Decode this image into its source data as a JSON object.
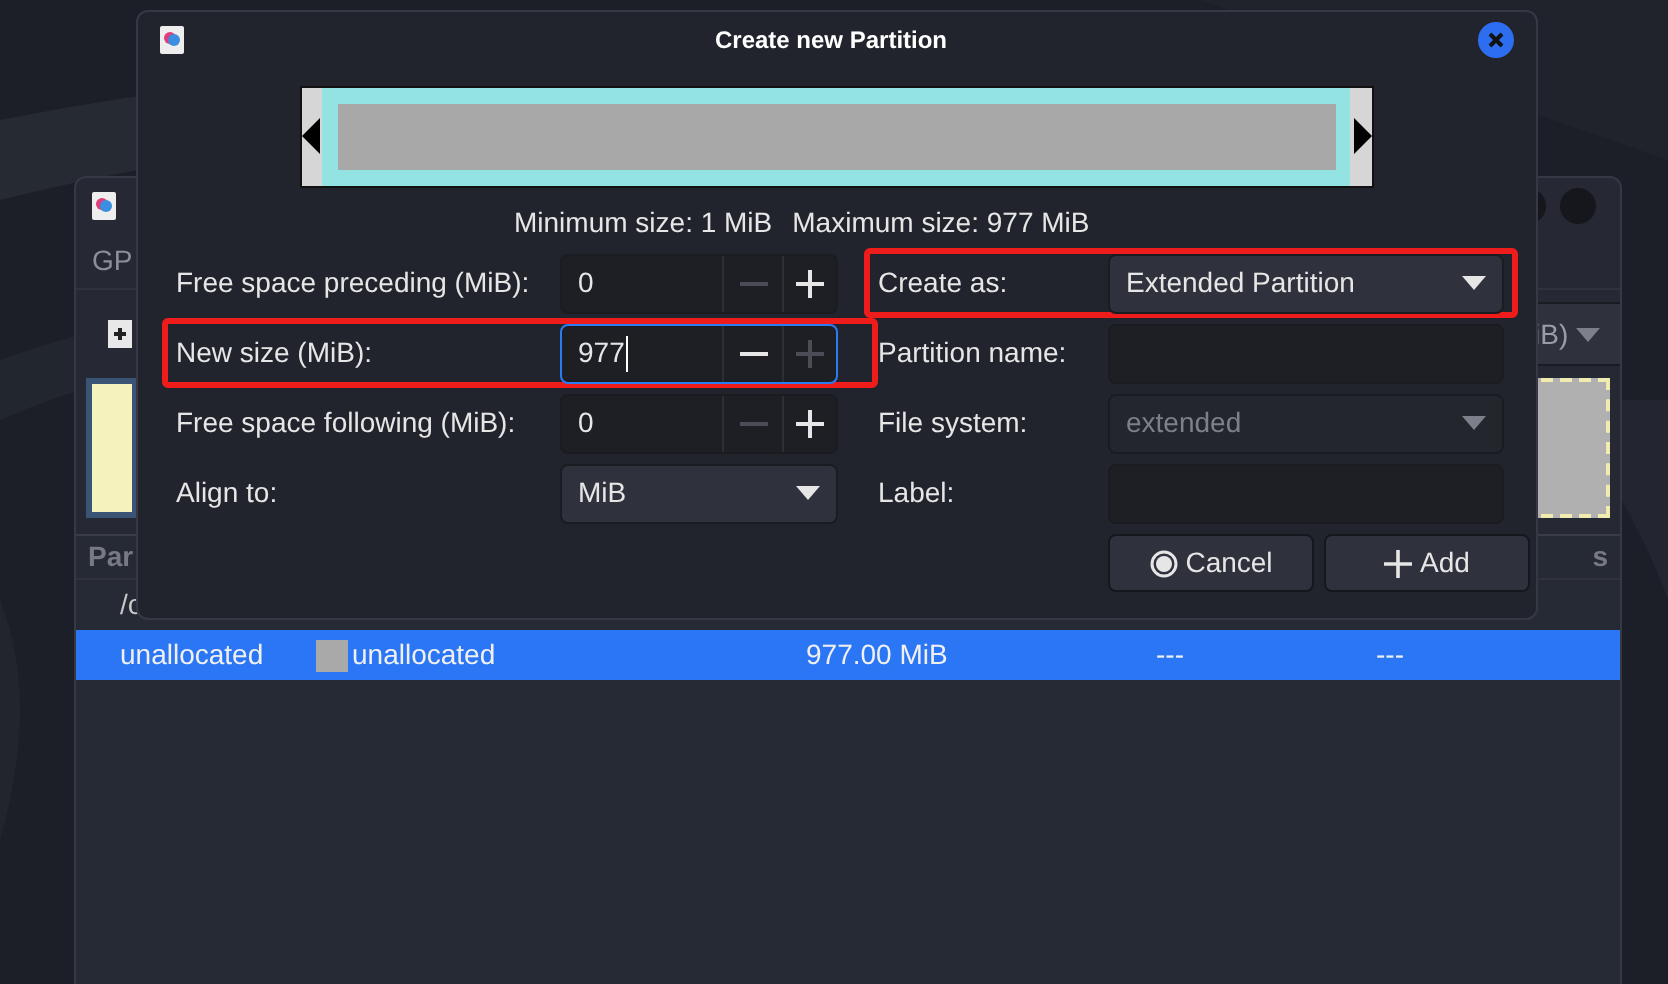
{
  "background_window": {
    "title_fragment": "GP",
    "toolbar_combo": "iB)",
    "table": {
      "columns": [
        "Par",
        "s"
      ],
      "rows": [
        {
          "cells": [
            "/c"
          ],
          "selected": false
        },
        {
          "cells": [
            "unallocated",
            "unallocated",
            "977.00 MiB",
            "---",
            "---"
          ],
          "selected": true
        }
      ]
    }
  },
  "dialog": {
    "title": "Create new Partition",
    "min_size": "Minimum size: 1 MiB",
    "max_size": "Maximum size: 977 MiB",
    "left_fields": [
      {
        "kind": "spin",
        "label": "Free space preceding (MiB):",
        "value": "0",
        "focused": false,
        "highlighted": false,
        "minus_disabled": true,
        "plus_disabled": false
      },
      {
        "kind": "spin",
        "label": "New size (MiB):",
        "value": "977",
        "focused": true,
        "highlighted": true,
        "minus_disabled": false,
        "plus_disabled": true
      },
      {
        "kind": "spin",
        "label": "Free space following (MiB):",
        "value": "0",
        "focused": false,
        "highlighted": false,
        "minus_disabled": true,
        "plus_disabled": false
      },
      {
        "kind": "combo",
        "label": "Align to:",
        "value": "MiB",
        "disabled": false,
        "highlighted": false
      }
    ],
    "right_fields": [
      {
        "kind": "combo",
        "label": "Create as:",
        "value": "Extended Partition",
        "disabled": false,
        "highlighted": true
      },
      {
        "kind": "entry",
        "label": "Partition name:",
        "highlighted": false
      },
      {
        "kind": "combo",
        "label": "File system:",
        "value": "extended",
        "disabled": true,
        "highlighted": false
      },
      {
        "kind": "entry",
        "label": "Label:",
        "highlighted": false
      }
    ],
    "buttons": [
      {
        "kind": "cancel",
        "label": "Cancel"
      },
      {
        "kind": "add",
        "label": "Add"
      }
    ]
  }
}
